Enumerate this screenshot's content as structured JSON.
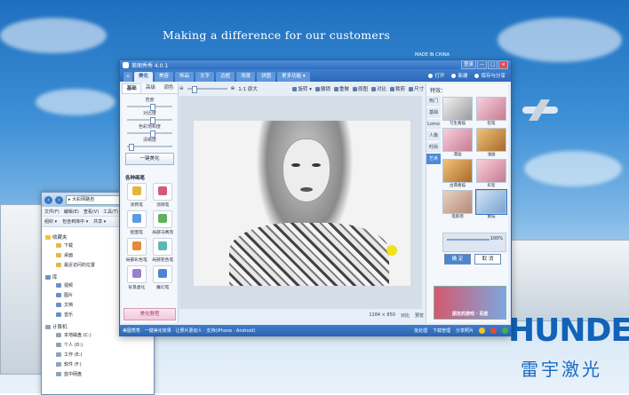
{
  "desktop": {
    "tagline": "Making a difference for our customers",
    "made_in": "MADE IN CHINA",
    "brand": "HUNDE",
    "brand_cn": "雷宇激光"
  },
  "explorer": {
    "address": "▸ 大彩网路自",
    "menu": [
      "文件(F)",
      "编辑(E)",
      "查看(V)",
      "工具(T)"
    ],
    "tools": [
      "组织 ▾",
      "包含到库中 ▾",
      "共享 ▾"
    ],
    "favorites": {
      "label": "收藏夹",
      "items": [
        "下载",
        "桌面",
        "最近访问的位置"
      ]
    },
    "libraries": {
      "label": "库",
      "items": [
        "视频",
        "图片",
        "文档",
        "音乐"
      ]
    },
    "computer": {
      "label": "计算机",
      "items": [
        "本地磁盘 (C:)",
        "个人 (D:)",
        "工作 (E:)",
        "软件 (F:)",
        "蓝中网盘"
      ]
    }
  },
  "meitu": {
    "title": "美图秀秀 4.0.1",
    "window_controls": [
      "登录",
      "—",
      "□",
      "×"
    ],
    "tabs": [
      "美化",
      "美容",
      "饰品",
      "文字",
      "边框",
      "场景",
      "拼图",
      "更多功能 ▾"
    ],
    "right_actions": [
      "打开",
      "新建",
      "保存与分享"
    ],
    "sub_tabs": [
      "基础",
      "高级",
      "调色"
    ],
    "sliders": [
      "亮度",
      "对比度",
      "色彩饱和度",
      "清晰度"
    ],
    "one_click": "一键美化",
    "brushes_title": "各种画笔",
    "brushes": [
      "涂鸦笔",
      "消除笔",
      "抠图笔",
      "局部马赛克",
      "局部彩色笔",
      "局部变色笔",
      "背景虚化",
      "魔幻笔"
    ],
    "beauty_btn": "美化教程",
    "toolbar": {
      "zoom_label": "1:1 原大",
      "rotate": "旋转 ▾",
      "undo": "撤销",
      "redo": "重做",
      "orig": "原图",
      "compare": "对比",
      "crop": "裁剪",
      "size": "尺寸"
    },
    "canvas_status": {
      "size": "1184 × 850",
      "compare": "对比",
      "preview": "预览"
    },
    "effects": {
      "title": "特效：",
      "categories": [
        "热门",
        "基础",
        "Lomo",
        "人像",
        "时尚",
        "艺术"
      ],
      "thumbs": [
        "写生素描",
        "铅笔",
        "漫画",
        "油画",
        "古典素描",
        "彩铅",
        "电影感",
        "素描"
      ],
      "opacity": "100%",
      "ok": "确 定",
      "cancel": "取 消",
      "ad": "朋友的游戏 · 百度"
    },
    "status": {
      "left": "美图秀秀 · 一键美化效果 · 让照片更动人 · 支持(iPhone · Android)",
      "mid": "批处理",
      "download": "下载管理",
      "share": "分享照片"
    }
  }
}
